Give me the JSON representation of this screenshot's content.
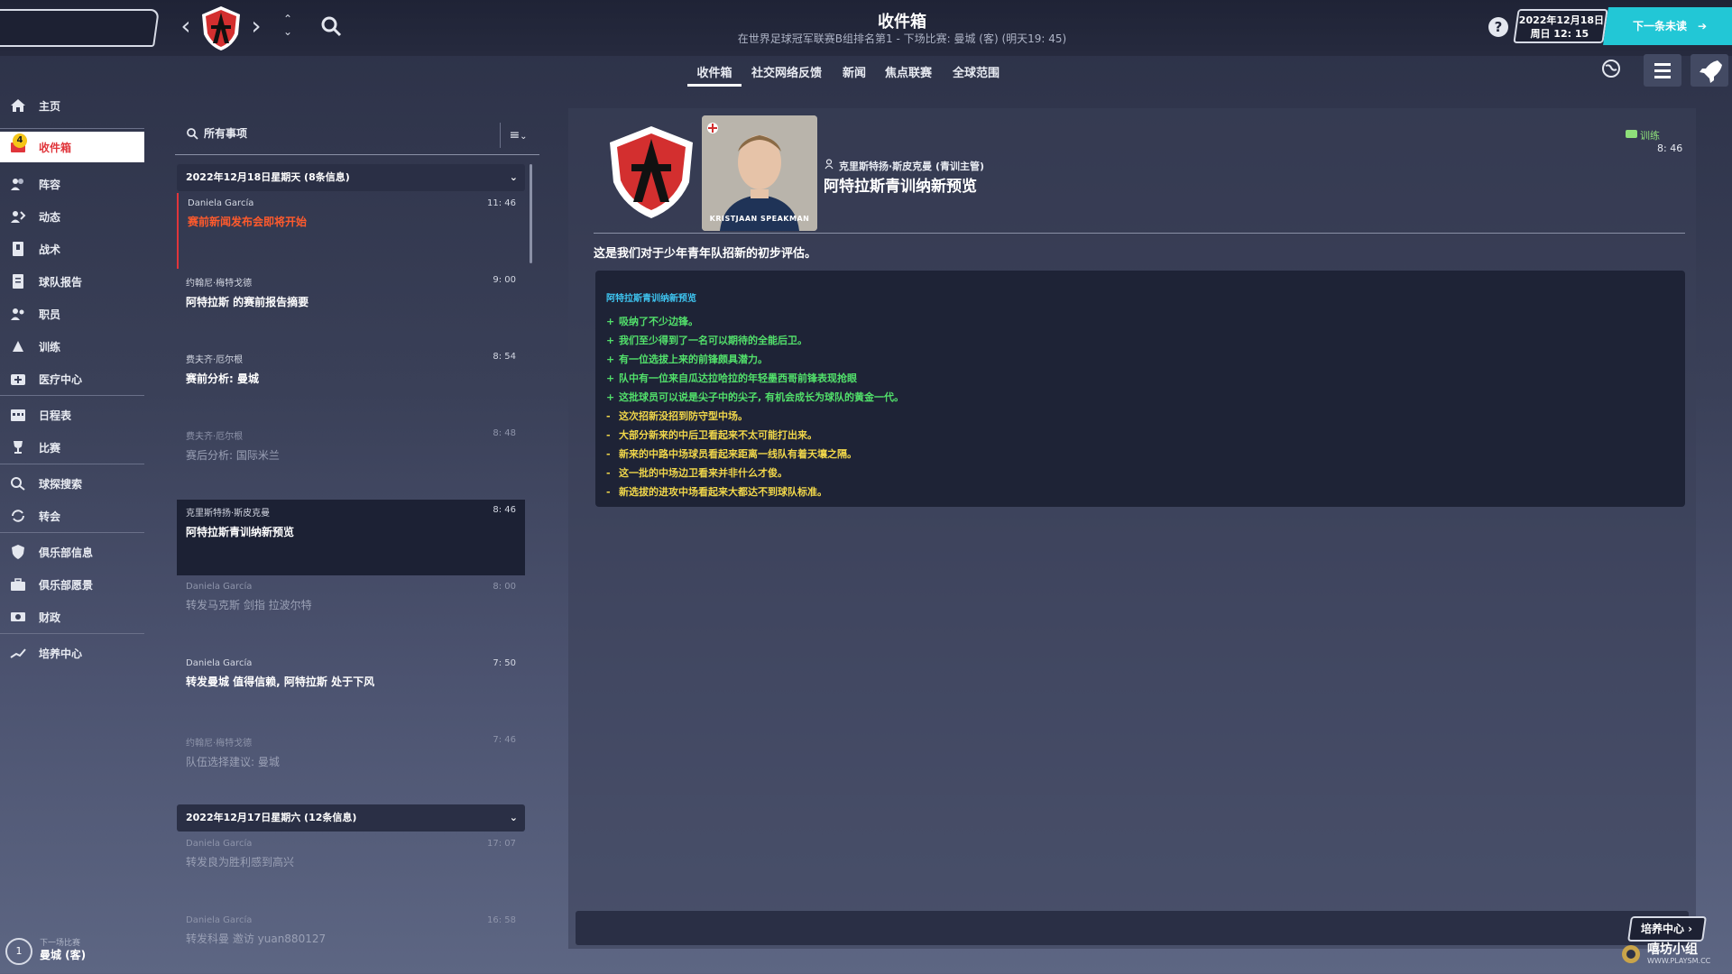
{
  "header": {
    "title": "收件箱",
    "subtitle": "在世界足球冠军联赛B组排名第1 - 下场比赛: 曼城 (客) (明天19: 45)",
    "date_line1": "2022年12月18日",
    "date_line2": "周日 12: 15",
    "next_label": "下一条未读",
    "help": "?"
  },
  "tabs": [
    {
      "label": "收件箱",
      "active": true
    },
    {
      "label": "社交网络反馈"
    },
    {
      "label": "新闻"
    },
    {
      "label": "焦点联赛"
    },
    {
      "label": "全球范围"
    }
  ],
  "sidebar": {
    "items": [
      {
        "label": "主页",
        "icon": "home-icon"
      },
      {
        "label": "收件箱",
        "icon": "inbox-icon",
        "active": true,
        "badge": "4"
      },
      {
        "label": "阵容",
        "icon": "squad-icon"
      },
      {
        "label": "动态",
        "icon": "dynamics-icon"
      },
      {
        "label": "战术",
        "icon": "tactics-icon"
      },
      {
        "label": "球队报告",
        "icon": "report-icon"
      },
      {
        "label": "职员",
        "icon": "staff-icon"
      },
      {
        "label": "训练",
        "icon": "training-icon"
      },
      {
        "label": "医疗中心",
        "icon": "medical-icon"
      },
      {
        "label": "日程表",
        "icon": "calendar-icon"
      },
      {
        "label": "比赛",
        "icon": "trophy-icon"
      },
      {
        "label": "球探搜索",
        "icon": "scouting-icon"
      },
      {
        "label": "转会",
        "icon": "transfer-icon"
      },
      {
        "label": "俱乐部信息",
        "icon": "club-info-icon"
      },
      {
        "label": "俱乐部愿景",
        "icon": "club-vision-icon"
      },
      {
        "label": "财政",
        "icon": "finance-icon"
      },
      {
        "label": "培养中心",
        "icon": "development-icon"
      }
    ],
    "next_match_label": "下一场比赛",
    "next_match_value": "曼城 (客)",
    "next_match_number": "1"
  },
  "list": {
    "all_items_label": "所有事项",
    "groups": [
      {
        "label": "2022年12月18日星期天 (8条信息)"
      },
      {
        "label": "2022年12月17日星期六 (12条信息)"
      }
    ],
    "messages": [
      {
        "from": "Daniela García",
        "time": "11: 46",
        "subject": "赛前新闻发布会即将开始"
      },
      {
        "from": "约翰尼·梅特戈德",
        "time": "9: 00",
        "subject": "阿特拉斯 的赛前报告摘要"
      },
      {
        "from": "费夫齐·厄尔根",
        "time": "8: 54",
        "subject": "赛前分析: 曼城"
      },
      {
        "from": "费夫齐·厄尔根",
        "time": "8: 48",
        "subject": "赛后分析: 国际米兰"
      },
      {
        "from": "克里斯特扬·斯皮克曼",
        "time": "8: 46",
        "subject": "阿特拉斯青训纳新预览"
      },
      {
        "from": "Daniela García",
        "time": "8: 00",
        "subject": "转发马克斯 剑指 拉波尔特"
      },
      {
        "from": "Daniela García",
        "time": "7: 50",
        "subject": "转发曼城 值得信赖, 阿特拉斯 处于下风"
      },
      {
        "from": "约翰尼·梅特戈德",
        "time": "7: 46",
        "subject": "队伍选择建议: 曼城"
      },
      {
        "from": "Daniela García",
        "time": "17: 07",
        "subject": "转发良为胜利感到高兴"
      },
      {
        "from": "Daniela García",
        "time": "16: 58",
        "subject": "转发科曼 邀访 yuan880127"
      }
    ]
  },
  "detail": {
    "sender": "克里斯特扬·斯皮克曼 (青训主管)",
    "subject": "阿特拉斯青训纳新预览",
    "category": "训练",
    "time": "8: 46",
    "photo_caption": "KRISTJAAN SPEAKMAN",
    "intro": "这是我们对于少年青年队招新的初步评估。",
    "report_title": "阿特拉斯青训纳新预览",
    "points": [
      {
        "sign": "+",
        "text": "吸纳了不少边锋。",
        "kind": "pos"
      },
      {
        "sign": "+",
        "text": "我们至少得到了一名可以期待的全能后卫。",
        "kind": "pos"
      },
      {
        "sign": "+",
        "text": "有一位选拔上来的前锋颇具潜力。",
        "kind": "pos"
      },
      {
        "sign": "+",
        "text": "队中有一位来自瓜达拉哈拉的年轻墨西哥前锋表现抢眼",
        "kind": "pos"
      },
      {
        "sign": "+",
        "text": "这批球员可以说是尖子中的尖子, 有机会成长为球队的黄金一代。",
        "kind": "pos"
      },
      {
        "sign": "-",
        "text": "这次招新没招到防守型中场。",
        "kind": "neg"
      },
      {
        "sign": "-",
        "text": "大部分新来的中后卫看起来不太可能打出来。",
        "kind": "neg"
      },
      {
        "sign": "-",
        "text": "新来的中路中场球员看起来距离一线队有着天壤之隔。",
        "kind": "neg"
      },
      {
        "sign": "-",
        "text": "这一批的中场边卫看来并非什么才俊。",
        "kind": "neg"
      },
      {
        "sign": "-",
        "text": "新选拔的进攻中场看起来大都达不到球队标准。",
        "kind": "neg"
      }
    ],
    "dev_center_button": "培养中心 ›"
  },
  "watermark": {
    "text": "嘻坊小组",
    "url": "WWW.PLAYSM.CC"
  },
  "colors": {
    "accent": "#22c7d6",
    "brand_red": "#e0353b",
    "positive": "#52e06b",
    "negative": "#f0d64a",
    "link": "#3ec4f0"
  }
}
